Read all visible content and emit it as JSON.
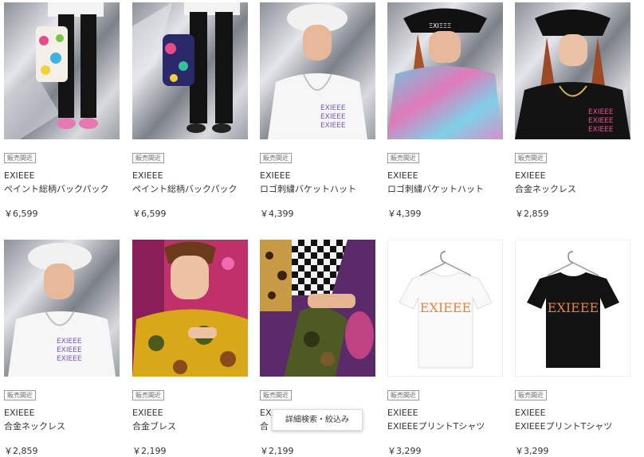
{
  "products": [
    {
      "badge": "販売間近",
      "brand": "EXIEEE",
      "name": "ペイント総柄バックパック",
      "price": "￥6,599",
      "photo": "model-legs-painted-backpack"
    },
    {
      "badge": "販売間近",
      "brand": "EXIEEE",
      "name": "ペイント総柄バックパック",
      "price": "￥6,599",
      "photo": "model-legs-backpack-side"
    },
    {
      "badge": "販売間近",
      "brand": "EXIEEE",
      "name": "ロゴ刺繍バケットハット",
      "price": "￥4,399",
      "photo": "model-white-bucket-hat"
    },
    {
      "badge": "販売間近",
      "brand": "EXIEEE",
      "name": "ロゴ刺繍バケットハット",
      "price": "￥4,399",
      "photo": "model-black-bucket-hat-tiedye"
    },
    {
      "badge": "販売間近",
      "brand": "EXIEEE",
      "name": "合金ネックレス",
      "price": "￥2,859",
      "photo": "model-black-hat-necklace"
    },
    {
      "badge": "販売間近",
      "brand": "EXIEEE",
      "name": "合金ネックレス",
      "price": "￥2,859",
      "photo": "model-white-hat-necklace"
    },
    {
      "badge": "販売間近",
      "brand": "EXIEEE",
      "name": "合金ブレス",
      "price": "￥2,199",
      "photo": "model-camo-bracelet"
    },
    {
      "badge": "販売間近",
      "brand": "EX",
      "name": "合",
      "price": "￥2,199",
      "photo": "model-checker-bracelet"
    },
    {
      "badge": "販売間近",
      "brand": "EXIEEE",
      "name": "EXIEEEプリントTシャツ",
      "price": "￥3,299",
      "photo": "white-tshirt-orange-logo",
      "logo": "EXIEEE"
    },
    {
      "badge": "販売間近",
      "brand": "EXIEEE",
      "name": "EXIEEEプリントTシャツ",
      "price": "￥3,299",
      "photo": "black-tshirt-orange-logo",
      "logo": "EXIEEE"
    }
  ],
  "tooltip": {
    "label": "詳細検索・絞込み"
  },
  "colors": {
    "accent_orange": "#e8843c",
    "foil": "#b9bcc2",
    "tiedye_pink": "#e07ab8",
    "tiedye_blue": "#6fc4e0"
  }
}
